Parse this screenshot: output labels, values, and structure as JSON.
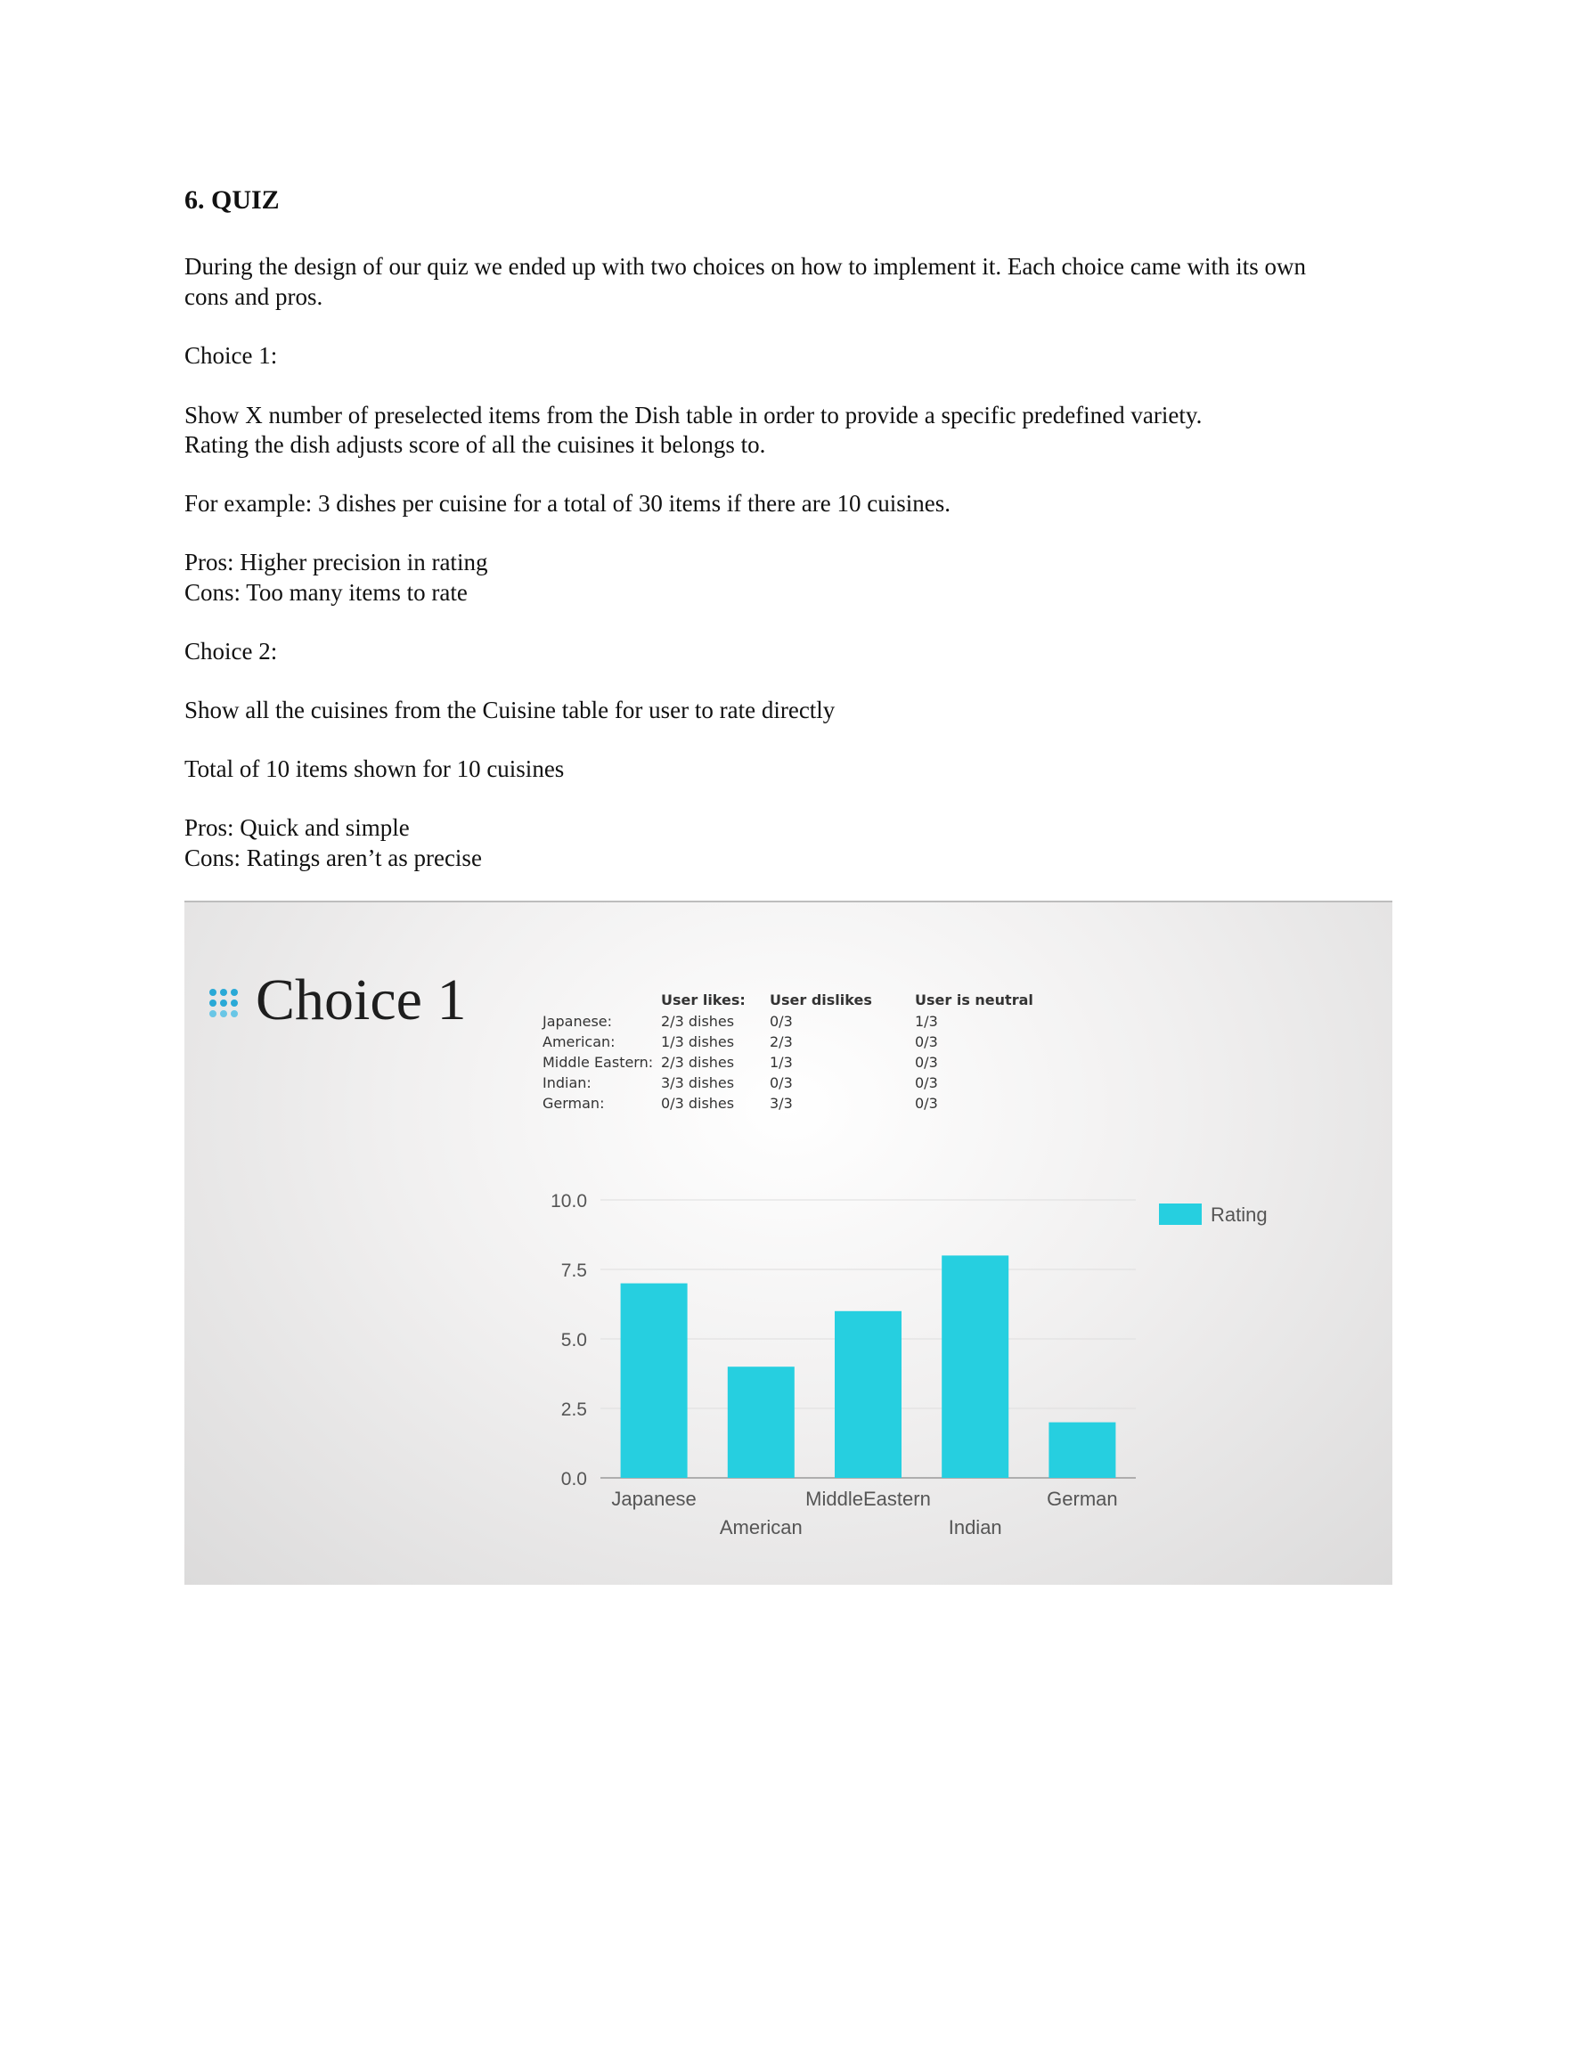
{
  "doc": {
    "heading": "6. QUIZ",
    "intro_line1": "During the design of our quiz we ended up with two choices on how to implement it. Each choice came with its own",
    "intro_line2": "cons and pros.",
    "choice1_label": "Choice 1:",
    "choice1_desc1": "Show X number of preselected items from the Dish table in order to provide a specific predefined variety.",
    "choice1_desc2": "Rating the dish adjusts score of all the cuisines it belongs to.",
    "choice1_example": "For example: 3 dishes per cuisine for a total of 30 items if there are 10 cuisines.",
    "choice1_pros": "Pros: Higher precision in rating",
    "choice1_cons": "Cons: Too many items to rate",
    "choice2_label": "Choice 2:",
    "choice2_desc": "Show all the cuisines from the Cuisine table for user to rate directly",
    "choice2_total": "Total of 10 items shown for 10 cuisines",
    "choice2_pros": "Pros: Quick and simple",
    "choice2_cons": "Cons: Ratings aren’t as precise"
  },
  "slide": {
    "title": "Choice 1",
    "icon": "dot-grid-icon",
    "table": {
      "headers": [
        "User likes:",
        "User dislikes",
        "User is neutral"
      ],
      "rows": [
        {
          "cuisine": "Japanese:",
          "likes": "2/3 dishes",
          "dislikes": "0/3",
          "neutral": "1/3"
        },
        {
          "cuisine": "American:",
          "likes": "1/3 dishes",
          "dislikes": "2/3",
          "neutral": "0/3"
        },
        {
          "cuisine": "Middle Eastern:",
          "likes": "2/3 dishes",
          "dislikes": "1/3",
          "neutral": "0/3"
        },
        {
          "cuisine": "Indian:",
          "likes": "3/3 dishes",
          "dislikes": "0/3",
          "neutral": "0/3"
        },
        {
          "cuisine": "German:",
          "likes": "0/3 dishes",
          "dislikes": "3/3",
          "neutral": "0/3"
        }
      ]
    }
  },
  "chart_data": {
    "type": "bar",
    "categories": [
      "Japanese",
      "American",
      "MiddleEastern",
      "Indian",
      "German"
    ],
    "series": [
      {
        "name": "Rating",
        "values": [
          7,
          4,
          6,
          8,
          2
        ],
        "color": "#26cfe0"
      }
    ],
    "yticks": [
      "0.0",
      "2.5",
      "5.0",
      "7.5",
      "10.0"
    ],
    "ylim": [
      0,
      10
    ],
    "grid": true,
    "legend": "right"
  }
}
